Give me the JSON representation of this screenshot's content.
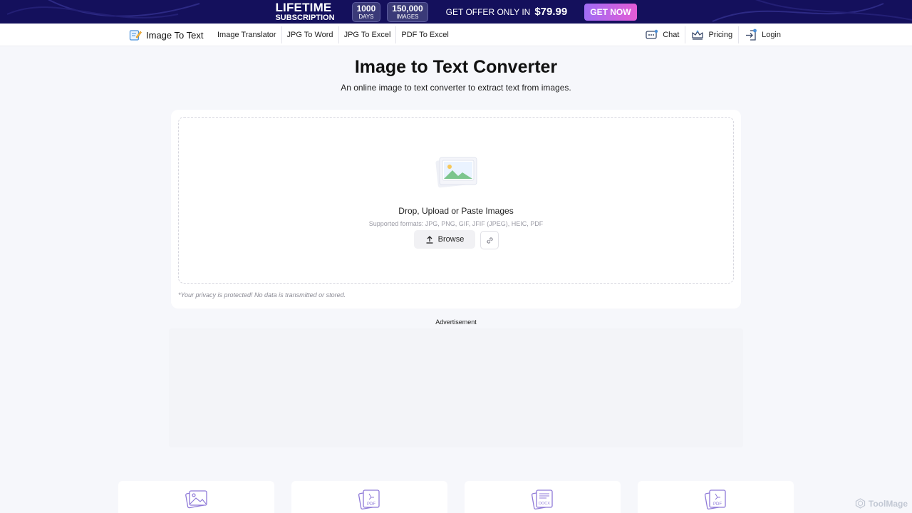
{
  "promo": {
    "title_line1": "LIFETIME",
    "title_line2": "SUBSCRIPTION",
    "badge1_num": "1000",
    "badge1_sub": "DAYS",
    "badge2_num": "150,000",
    "badge2_sub": "IMAGES",
    "offer_text": "GET OFFER ONLY IN",
    "price": "$79.99",
    "cta": "GET NOW"
  },
  "nav": {
    "brand": "Image To Text",
    "links": [
      "Image Translator",
      "JPG To Word",
      "JPG To Excel",
      "PDF To Excel"
    ],
    "chat": "Chat",
    "pricing": "Pricing",
    "login": "Login"
  },
  "hero": {
    "title": "Image to Text Converter",
    "subtitle": "An online image to text converter to extract text from images."
  },
  "upload": {
    "title": "Drop, Upload or Paste Images",
    "formats": "Supported formats: JPG, PNG, GIF, JFIF (JPEG), HEIC, PDF",
    "browse": "Browse",
    "privacy": "*Your privacy is protected! No data is transmitted or stored."
  },
  "ad": {
    "label": "Advertisement"
  },
  "tools": {
    "icons": [
      "image-stack-icon",
      "pdf-stack-icon",
      "docx-stack-icon",
      "pdf-stack-icon"
    ],
    "badges": [
      "",
      "PDF",
      "DOCX",
      "PDF"
    ]
  },
  "watermark": {
    "text": "ToolMage"
  },
  "colors": {
    "banner_bg": "#14105c",
    "cta_gradient_start": "#a06cf4",
    "cta_gradient_end": "#e45bd5",
    "icon_purple": "#8f7ad8",
    "page_bg": "#f6f7fb"
  }
}
